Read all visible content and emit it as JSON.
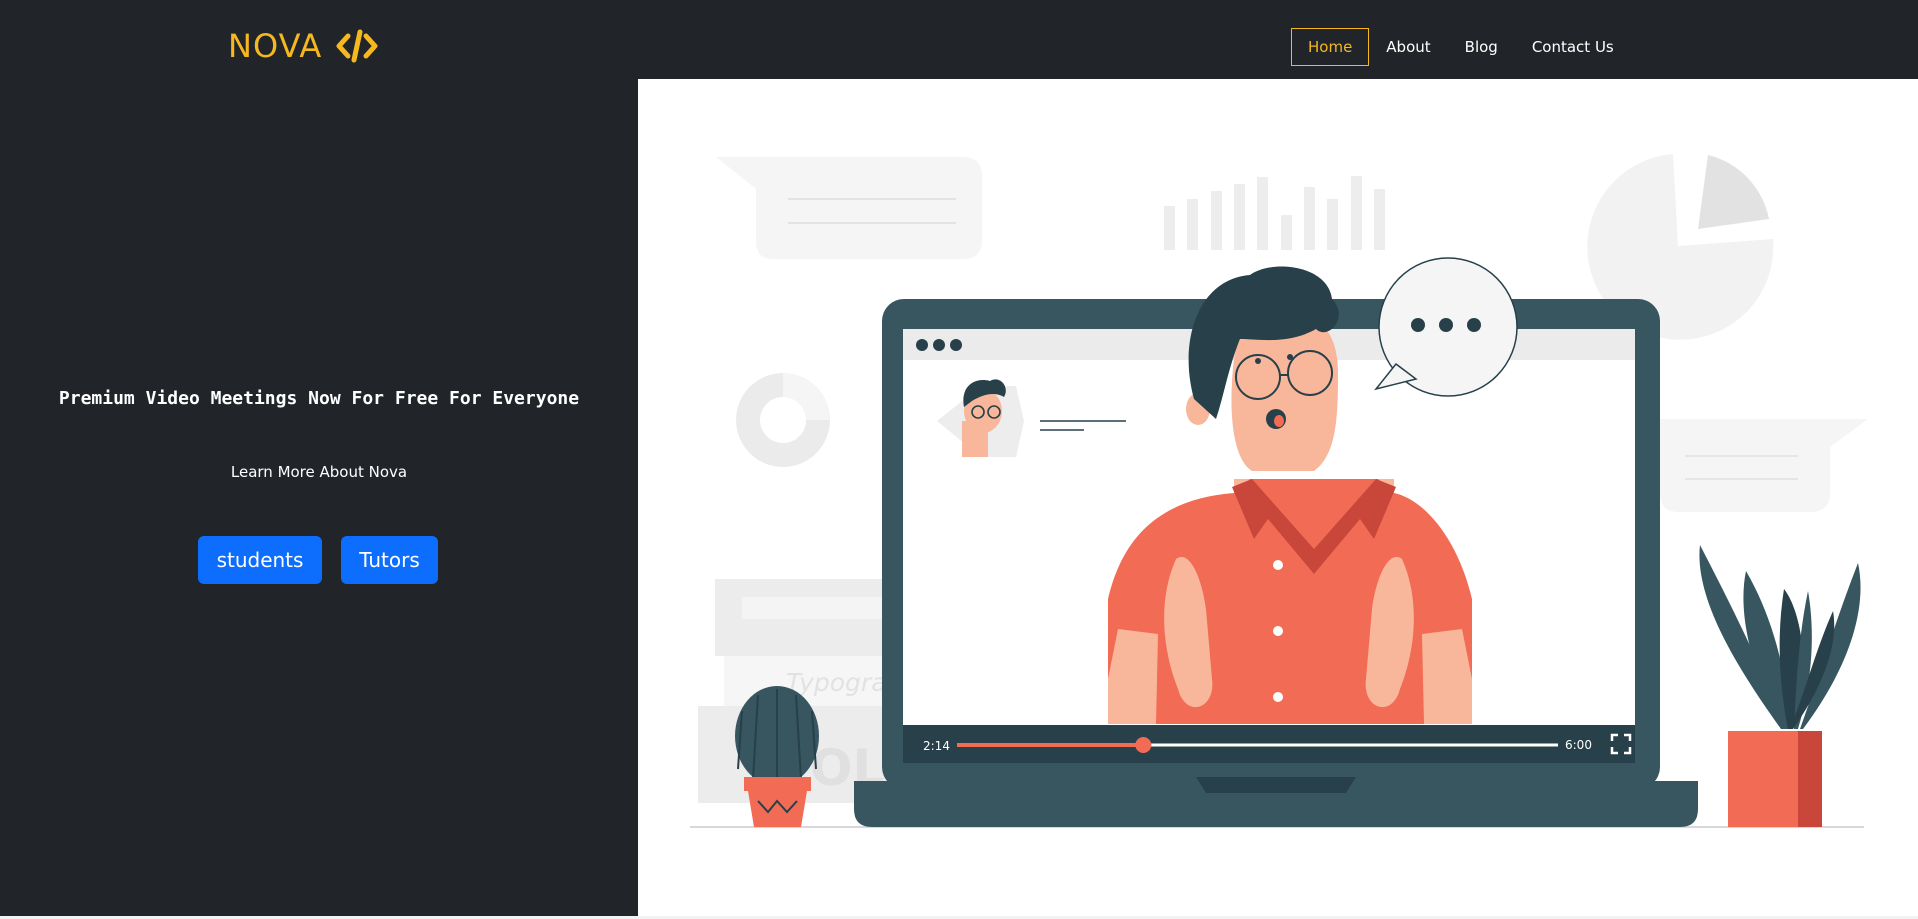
{
  "brand": {
    "name": "NOVA",
    "icon": "code-icon",
    "color": "#f5b81f"
  },
  "nav": {
    "items": [
      {
        "label": "Home",
        "active": true
      },
      {
        "label": "About",
        "active": false
      },
      {
        "label": "Blog",
        "active": false
      },
      {
        "label": "Contact Us",
        "active": false
      }
    ]
  },
  "hero": {
    "title": "Premium Video Meetings Now For Free For Everyone",
    "link": "Learn More About Nova",
    "buttons": {
      "students": "students",
      "tutors": "Tutors"
    }
  },
  "video_player": {
    "current_time": "2:14",
    "duration": "6:00",
    "progress": 0.31,
    "fullscreen_icon": "fullscreen-icon"
  },
  "illustration": {
    "book_text": "Typogra"
  },
  "colors": {
    "accent": "#f5b81f",
    "primary_button": "#0d6efd",
    "dark_bg": "#212529",
    "coral": "#f26b55",
    "laptop": "#37565f"
  }
}
